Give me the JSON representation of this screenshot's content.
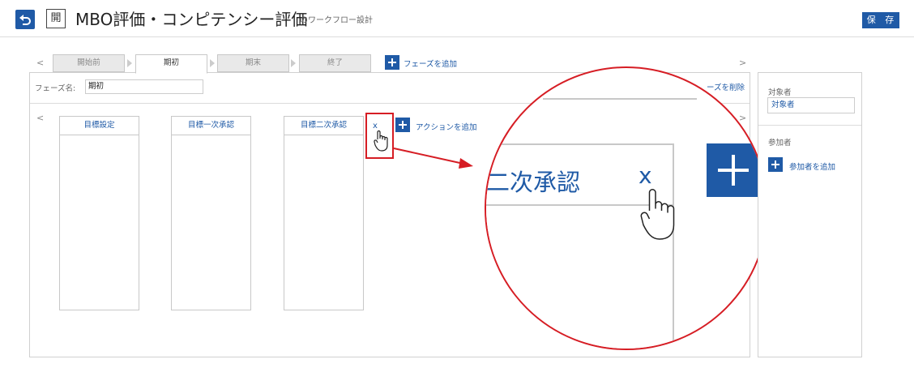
{
  "header": {
    "open_badge": "開",
    "title": "MBO評価・コンピテンシー評価",
    "subtitle": "のワークフロー設計",
    "save_label": "保 存"
  },
  "phase_nav": {
    "prev": "<",
    "next": ">",
    "tabs": [
      {
        "label": "開始前",
        "active": false
      },
      {
        "label": "期初",
        "active": true
      },
      {
        "label": "期末",
        "active": false
      },
      {
        "label": "終了",
        "active": false
      }
    ],
    "add_phase_label": "フェーズを追加"
  },
  "phase_editor": {
    "name_label": "フェーズ名:",
    "name_value": "期初",
    "delete_label": "ーズを削除"
  },
  "actions": {
    "prev": "<",
    "next": ">",
    "columns": [
      {
        "label": "目標設定"
      },
      {
        "label": "目標一次承認"
      },
      {
        "label": "目標二次承認"
      }
    ],
    "delete_x": "x",
    "add_action_label": "アクションを追加"
  },
  "magnifier": {
    "zoomed_label": "二次承認",
    "zoomed_x": "x"
  },
  "side_panel": {
    "target_label": "対象者",
    "target_value": "対象者",
    "participants_label": "参加者",
    "add_participant_label": "参加者を追加"
  },
  "colors": {
    "accent": "#1f5aa6",
    "highlight": "#d61d24"
  }
}
